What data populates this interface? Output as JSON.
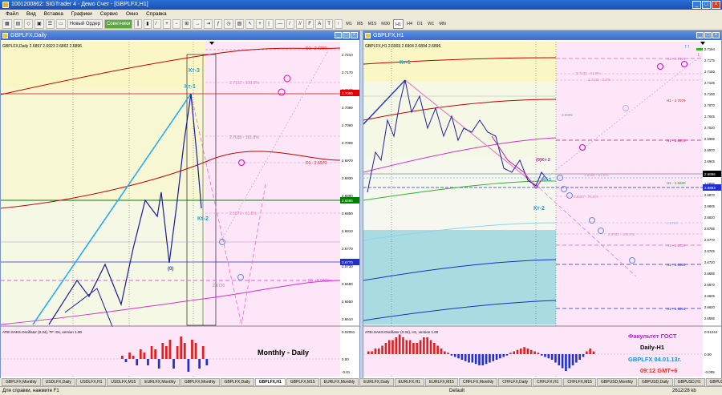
{
  "window": {
    "title": "1001200862: SIGTrader 4 - Демо Счет - [GBPLFX,H1]"
  },
  "menu": [
    "Файл",
    "Вид",
    "Вставка",
    "Графики",
    "Сервис",
    "Окно",
    "Справка"
  ],
  "toolbar": {
    "new_order": "Новый Ордер",
    "experts": "Советники",
    "timeframes": [
      "M1",
      "M5",
      "M15",
      "M30",
      "H1",
      "H4",
      "D1",
      "W1",
      "MN"
    ],
    "active_tf": "H1"
  },
  "left": {
    "title": "GBPLFX,Daily",
    "info": "GBPLFX,Daily 2.6897 2.6923 2.6862 2.6896",
    "labels": {
      "kt3": "Кт-3",
      "kt1": "Кт-1",
      "kt2": "Кт-2",
      "zero": "(0)"
    },
    "lines": {
      "d1_top": "D1 - 2.7209",
      "lvl_100": "2.7132 - 100.0%",
      "lvl_161": "2.7035 - 161.8%",
      "d1_mid": "D1 - 2.6970",
      "lvl_618": "2.6879 - 61.8%",
      "d1_low": "D1 - 2.6725",
      "lvl_2720": "2.6720"
    },
    "price_scale": [
      "2.7210",
      "2.7170",
      "2.7130",
      "2.7089",
      "2.7050",
      "2.7009",
      "2.6970",
      "2.6930",
      "2.6890",
      "2.6850",
      "2.6810",
      "2.6770",
      "2.6730",
      "2.6690",
      "2.6650",
      "2.6610"
    ],
    "price_tags": {
      "red": "2.7089",
      "green": "2.6896",
      "blue": "2.6770"
    },
    "osc_title": "ATEI.SAKS.Oscillator (0.34), TF: Ds, version 1.00",
    "osc_scale": [
      "0.02051",
      "0.00",
      "-0.01"
    ],
    "caption": "Monthly - Daily",
    "dates": [
      "16 Nov 2012",
      "22 Nov 2012",
      "28 Nov 2012",
      "4 Dec 2012",
      "10 Dec 2012",
      "16 Dec 2012",
      "21 Dec 2012",
      "27 Dec 2012",
      "3 Jan 2013"
    ]
  },
  "right": {
    "title": "GBPLFX,H1",
    "info": "GBPLFX,H1 2.6903 2.6904 2.6894 2.6896",
    "labels": {
      "kt1": "Кт-1",
      "kt2a": "Кт-2",
      "kt2b": "Кт-2",
      "kt3": "(0)Кт-2",
      "kt3b": "Кт-3"
    },
    "lines": {
      "h1_top": "H1 - 2.7174",
      "lvl_a": "2.7131 - 61.8%",
      "lvl_b": "2.7125 - 0.0%",
      "h1_2": "H1 - 2.7076",
      "h1_3": "H1 - 2.6978",
      "lvl_c": "2.6880 - 61.8%",
      "h1_4": "H1 - 2.6880",
      "lvl_d": "2.6847 - 76.4%",
      "lvl_e": "2.6790 - ...",
      "lvl_f": "2.6763 - 100.0%",
      "h1_5": "H1 - 2.6729",
      "h1_6": "H1 - 2.6680",
      "h1_7": "H1 - 2.6591",
      "lvl_g": "2.6999"
    },
    "price_scale": [
      "2.7194",
      "2.7175",
      "2.7150",
      "2.7125",
      "2.7100",
      "2.7070",
      "2.7045",
      "2.7020",
      "2.6995",
      "2.6970",
      "2.6945",
      "2.6920",
      "2.6895",
      "2.6870",
      "2.6845",
      "2.6820",
      "2.6795",
      "2.6770",
      "2.6745",
      "2.6720",
      "2.6695",
      "2.6670",
      "2.6645",
      "2.6620",
      "2.6595"
    ],
    "price_tags": {
      "cur": "2.6896",
      "blue": "2.6863"
    },
    "osc_title": "ATEI.SAKS.Oscillator (0.34), H1, version 1.00",
    "osc_scale": [
      "0.01244",
      "0.00",
      "-0.005"
    ],
    "caption": {
      "faculty": "Факультет ГОСТ",
      "tf": "Daily-H1",
      "pair": "GBPLFX 04.01.13г.",
      "time": "09:12 GMT+6"
    },
    "dates": [
      "21 Dec 2012",
      "31 Dec 17:00",
      "2 Jan 07:00",
      "2 Jan 15:00",
      "2 Jan 23:00",
      "3 Jan 07:00",
      "3 Jan 15:00",
      "3 Jan 23:00"
    ]
  },
  "tabs": [
    "GBPLFX,Monthly",
    "USDLFX,Daily",
    "USDLFX,H1",
    "USDLFX,M15",
    "EURLFX,Monthly",
    "GBPLFX,Monthly",
    "GBPLFX,Daily",
    "GBPLFX,H1",
    "GBPLFX,M15",
    "EURLFX,Monthly",
    "EURLFX,Daily",
    "EURLFX,H1",
    "EURLFX,M15",
    "CHFLFX,Monthly",
    "CHFLFX,Daily",
    "CHFLFX,H1",
    "CHFLFX,M15",
    "GBPUSD,Monthly",
    "GBPUSD,Daily",
    "GBPUSD,H1",
    "GBPUSD,M15",
    "EURUSD,Monthly",
    "EURUSD,Daily",
    "EURUSD,H1",
    "EURUSD,M15",
    "EURGBP,Monthly"
  ],
  "active_tab": "GBPLFX,H1",
  "status": {
    "help": "Для справки, нажмите F1",
    "profile": "Default",
    "kb": "2612/28 kb"
  }
}
